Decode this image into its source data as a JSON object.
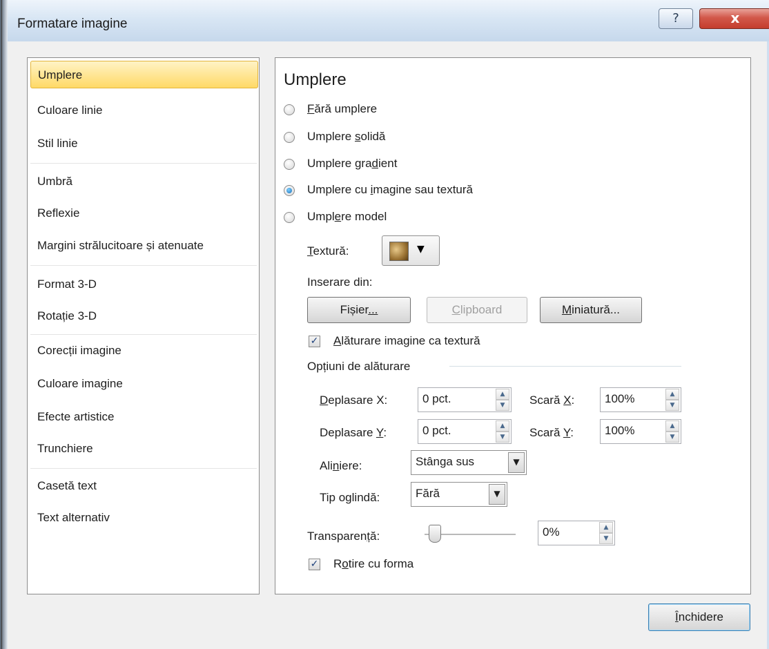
{
  "window": {
    "title": "Formatare imagine",
    "help_symbol": "?",
    "close_symbol": "x"
  },
  "sidebar": {
    "items": [
      {
        "label": "Umplere",
        "selected": true
      },
      {
        "label": "Culoare linie"
      },
      {
        "label": "Stil linie"
      },
      {
        "label": "Umbră"
      },
      {
        "label": "Reflexie"
      },
      {
        "label": "Margini strălucitoare și atenuate"
      },
      {
        "label": "Format 3-D"
      },
      {
        "label": "Rotație 3-D"
      },
      {
        "label": "Corecții imagine"
      },
      {
        "label": "Culoare imagine"
      },
      {
        "label": "Efecte artistice"
      },
      {
        "label": "Trunchiere"
      },
      {
        "label": "Casetă text"
      },
      {
        "label": "Text alternativ"
      }
    ]
  },
  "fill": {
    "heading": "Umplere",
    "options": [
      {
        "label_underlined": "F",
        "label_rest": "ără umplere",
        "selected": false
      },
      {
        "label_pre": "Umplere ",
        "label_underlined": "s",
        "label_rest": "olidă",
        "selected": false
      },
      {
        "label_pre": "Umplere gra",
        "label_underlined": "d",
        "label_rest": "ient",
        "selected": false
      },
      {
        "label_pre": "Umplere cu ",
        "label_underlined": "i",
        "label_rest": "magine sau textură",
        "selected": true
      },
      {
        "label_pre": "Umpl",
        "label_underlined": "e",
        "label_rest": "re model",
        "selected": false
      }
    ],
    "texture_label_u": "T",
    "texture_label_rest": "extură:",
    "insert_from": "Inserare din:",
    "file_button_pre": "Fișier",
    "file_button_u": "...",
    "clipboard_button_u": "C",
    "clipboard_button_rest": "lipboard",
    "clipart_button_u": "M",
    "clipart_button_rest": "iniatură...",
    "tile_checkbox_u": "A",
    "tile_checkbox_rest": "lăturare imagine ca textură",
    "tile_checked": true,
    "tiling_options_heading": "Opțiuni de alăturare",
    "offset_x_label_u": "D",
    "offset_x_label_rest": "eplasare X:",
    "offset_x_value": "0 pct.",
    "scale_x_label_pre": "Scară ",
    "scale_x_label_u": "X",
    "scale_x_label_rest": ":",
    "scale_x_value": "100%",
    "offset_y_label_pre": "Deplasare ",
    "offset_y_label_u": "Y",
    "offset_y_label_rest": ":",
    "offset_y_value": "0 pct.",
    "scale_y_label_pre": "Scară ",
    "scale_y_label_u": "Y",
    "scale_y_label_rest": ":",
    "scale_y_value": "100%",
    "align_label_pre": "Ali",
    "align_label_u": "n",
    "align_label_rest": "iere:",
    "align_value": "Stânga sus",
    "mirror_label_pre": "Tip o",
    "mirror_label_u": "g",
    "mirror_label_rest": "lindă:",
    "mirror_value": "Fără",
    "transparency_label_pre": "Transparen",
    "transparency_label_u": "ț",
    "transparency_label_rest": "ă:",
    "transparency_value": "0%",
    "transparency_level": 0,
    "rotate_checkbox_pre": "R",
    "rotate_checkbox_u": "o",
    "rotate_checkbox_rest": "tire cu forma",
    "rotate_checked": true
  },
  "footer": {
    "close_button_u": "Î",
    "close_button_rest": "nchidere"
  }
}
